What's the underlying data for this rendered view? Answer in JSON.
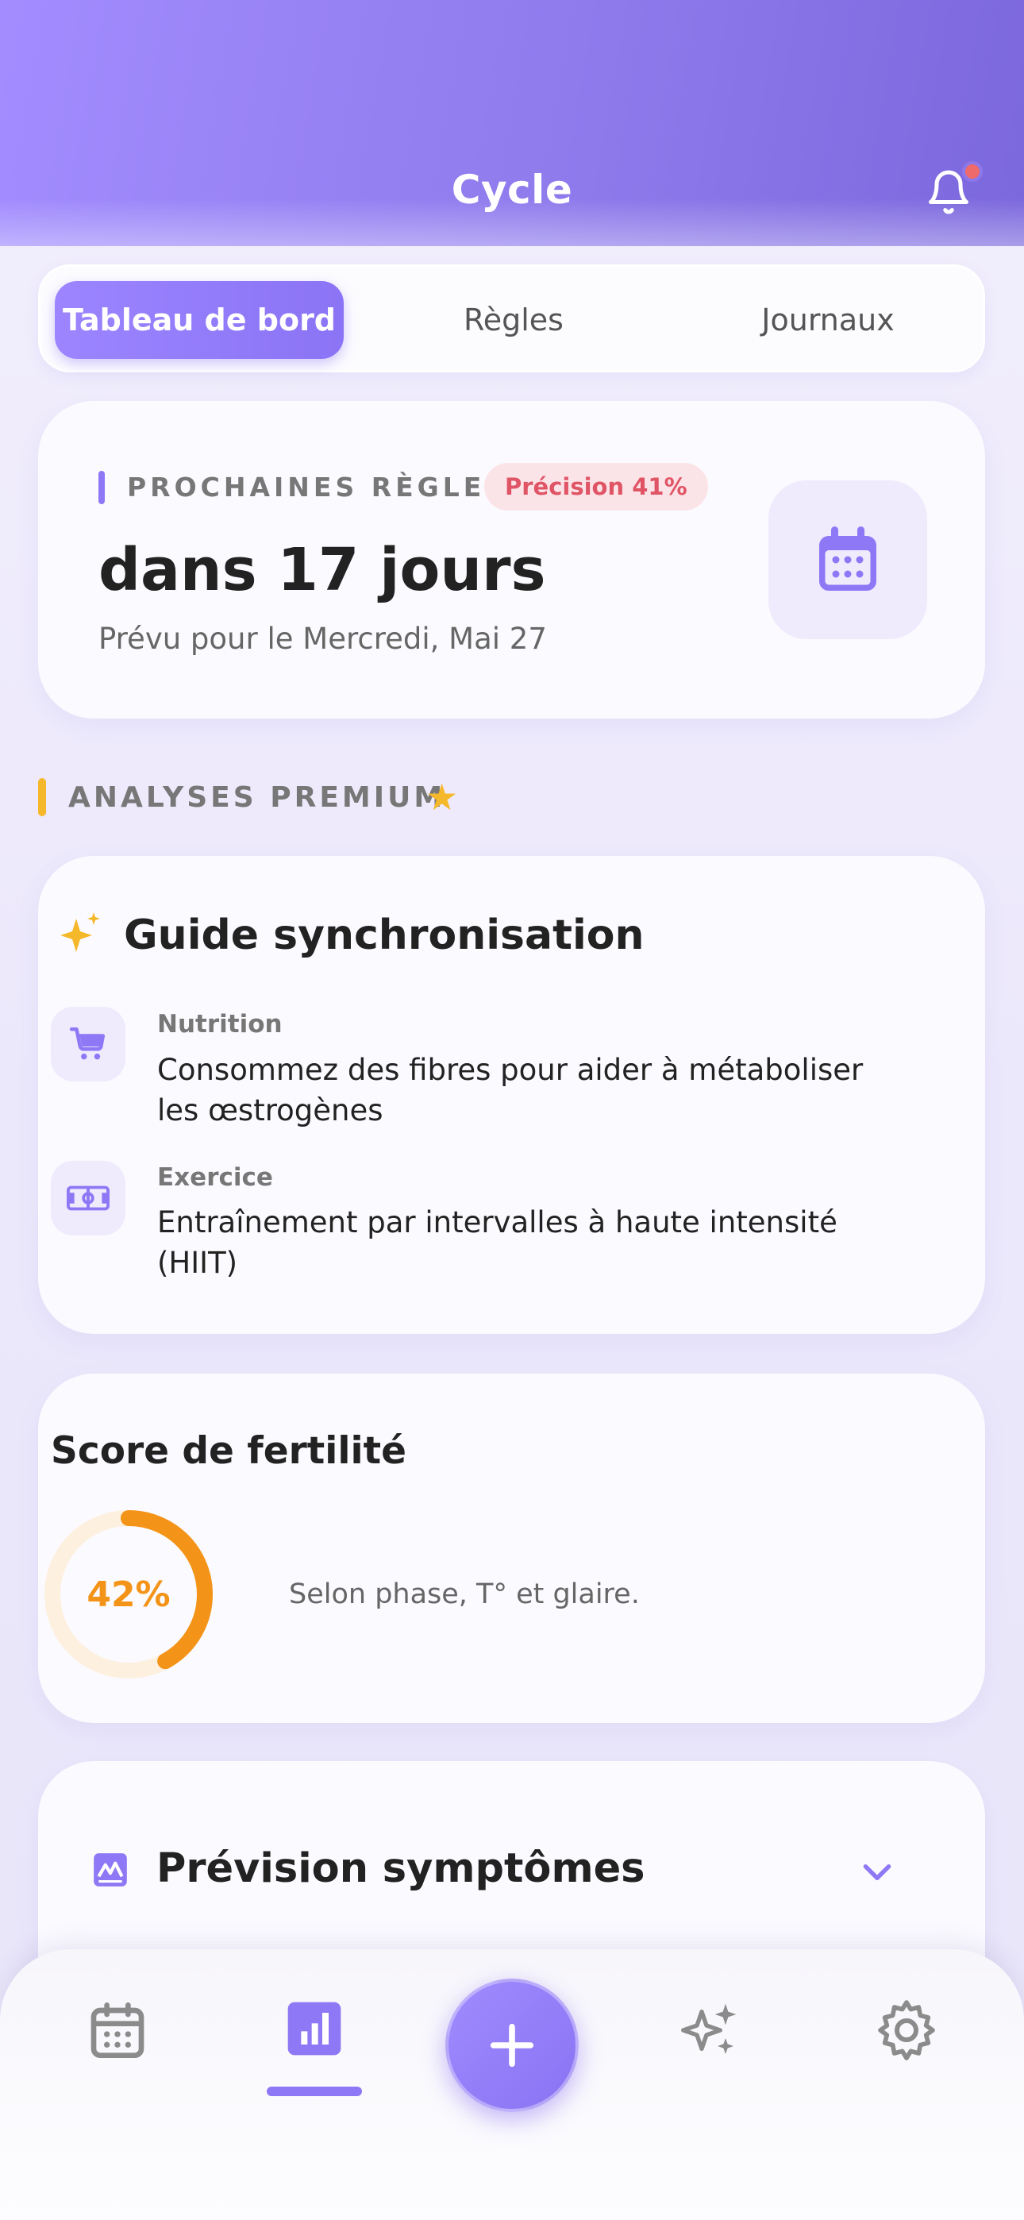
{
  "header": {
    "title": "Cycle"
  },
  "tabs": [
    {
      "label": "Tableau de bord",
      "active": true
    },
    {
      "label": "Règles",
      "active": false
    },
    {
      "label": "Journaux",
      "active": false
    }
  ],
  "next_period": {
    "label": "PROCHAINES RÈGLES",
    "badge": "Précision 41%",
    "days": "dans 17 jours",
    "date": "Prévu pour le Mercredi, Mai 27"
  },
  "premium": {
    "label": "ANALYSES PREMIUM",
    "star": "★"
  },
  "guide": {
    "title": "Guide synchronisation",
    "items": [
      {
        "category": "Nutrition",
        "text": "Consommez des fibres pour aider à métaboliser les œstrogènes",
        "icon": "cart-icon"
      },
      {
        "category": "Exercice",
        "text": "Entraînement par intervalles à haute intensité (HIIT)",
        "icon": "fitness-icon"
      }
    ]
  },
  "fertility": {
    "title": "Score de fertilité",
    "score_label": "42%",
    "score": 42,
    "description": "Selon phase, T° et glaire."
  },
  "symptoms": {
    "title": "Prévision symptômes"
  },
  "colors": {
    "accent": "#8f78f5",
    "premium": "#f5b82a",
    "fertility": "#f39418",
    "badge_text": "#e05566"
  },
  "nav": [
    {
      "icon": "calendar-icon",
      "active": false
    },
    {
      "icon": "insights-icon",
      "active": true
    },
    {
      "icon": "add-icon",
      "active": false
    },
    {
      "icon": "sparkles-icon",
      "active": false
    },
    {
      "icon": "gear-icon",
      "active": false
    }
  ]
}
